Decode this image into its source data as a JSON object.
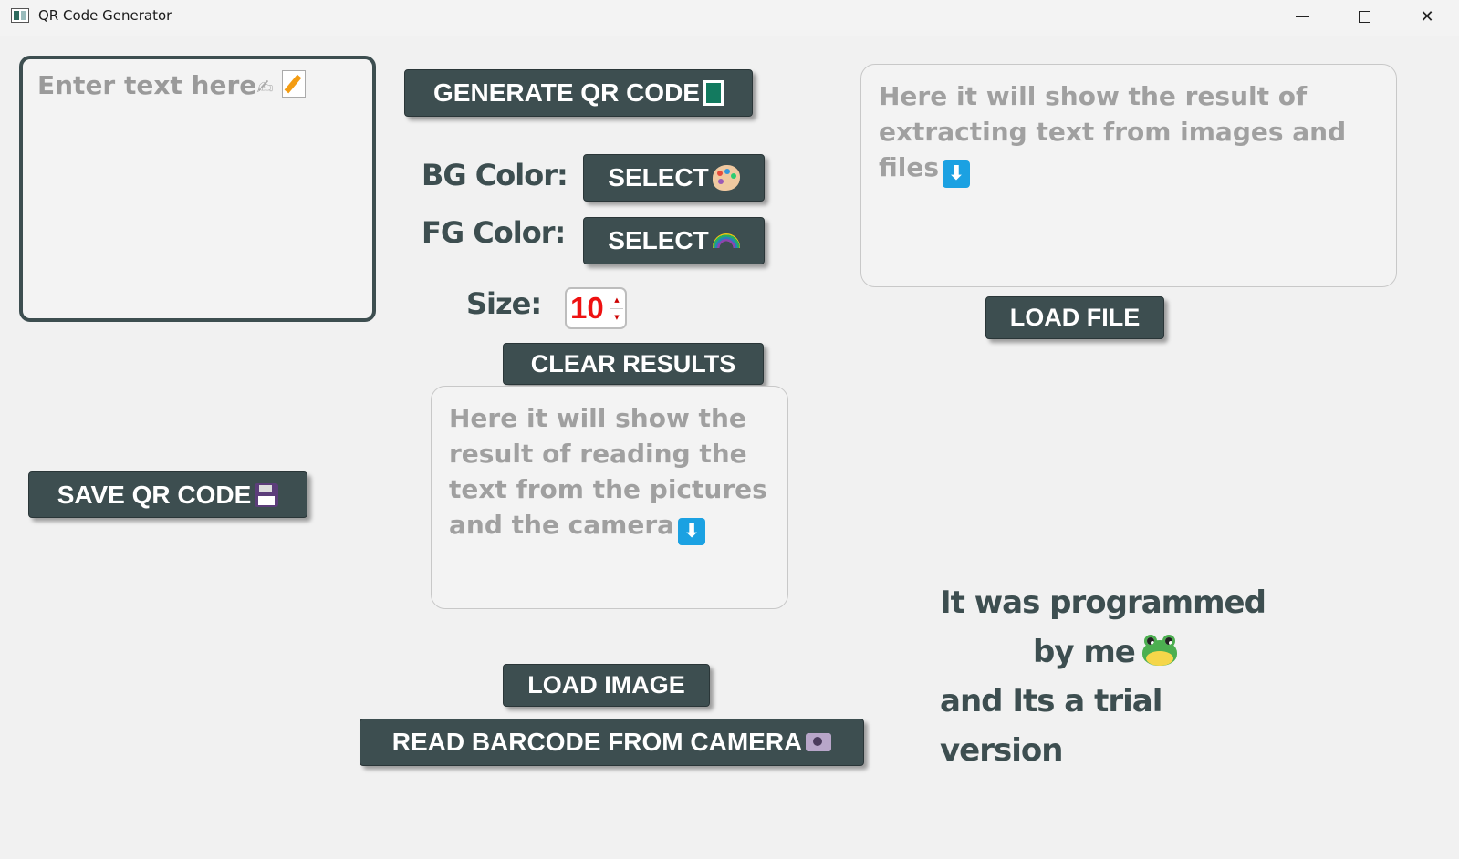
{
  "window": {
    "title": "QR Code Generator"
  },
  "input": {
    "placeholder": "Enter text here",
    "value": ""
  },
  "buttons": {
    "generate": "GENERATE QR CODE",
    "select_bg": "SELECT",
    "select_fg": "SELECT",
    "clear": "CLEAR RESULTS",
    "load_file": "LOAD FILE",
    "save": "SAVE QR CODE",
    "load_image": "LOAD IMAGE",
    "read_camera": "READ BARCODE FROM CAMERA"
  },
  "labels": {
    "bg_color": "BG Color:",
    "fg_color": "FG Color:",
    "size": "Size:"
  },
  "size": {
    "value": "10"
  },
  "results": {
    "file_placeholder": "Here it will show the result of extracting text from images and files",
    "camera_placeholder": "Here it will show the result of reading the text from the pictures and the camera"
  },
  "credit": {
    "line1": "It was programmed",
    "line2": "by me",
    "line3": "and Its a trial version"
  },
  "icons": {
    "generate": "qr-code-icon",
    "select_bg": "palette-icon",
    "select_fg": "rainbow-icon",
    "save": "floppy-disk-icon",
    "read_camera": "camera-icon",
    "input": "writing-hand-icon",
    "input2": "memo-icon",
    "results": "down-arrow-icon",
    "credit": "frog-icon"
  },
  "colors": {
    "button_bg": "#3d4e50",
    "button_text": "#ffffff",
    "placeholder_text": "#a0a0a0",
    "size_value": "#ee1111",
    "arrow_icon_bg": "#1ba1e2"
  }
}
